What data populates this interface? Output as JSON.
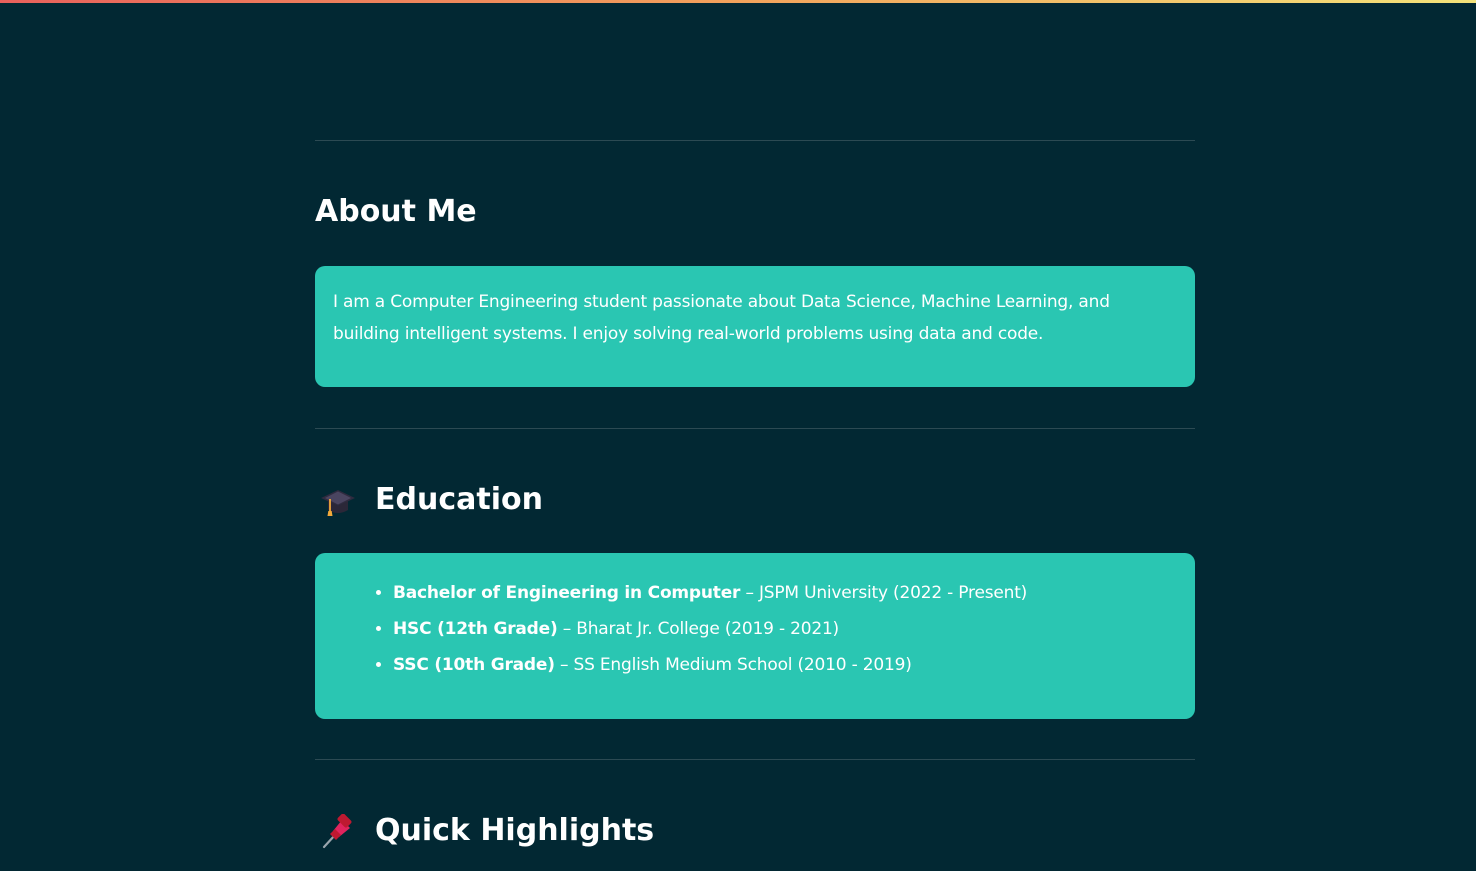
{
  "about": {
    "title": "About Me",
    "text": "I am a Computer Engineering student passionate about Data Science, Machine Learning, and building intelligent systems. I enjoy solving real-world problems using data and code."
  },
  "education": {
    "icon": "graduation-cap-icon",
    "title": "Education",
    "items": [
      {
        "degree": "Bachelor of Engineering in Computer",
        "separator": " – ",
        "detail": "JSPM University (2022 - Present)"
      },
      {
        "degree": "HSC (12th Grade)",
        "separator": " – ",
        "detail": "Bharat Jr. College (2019 - 2021)"
      },
      {
        "degree": "SSC (10th Grade)",
        "separator": " – ",
        "detail": "SS English Medium School (2010 - 2019)"
      }
    ]
  },
  "highlights": {
    "icon": "pushpin-icon",
    "title": "Quick Highlights"
  },
  "colors": {
    "background": "#022833",
    "card": "#2ac6b2",
    "text": "#ffffff",
    "divider": "#2c4a53"
  }
}
